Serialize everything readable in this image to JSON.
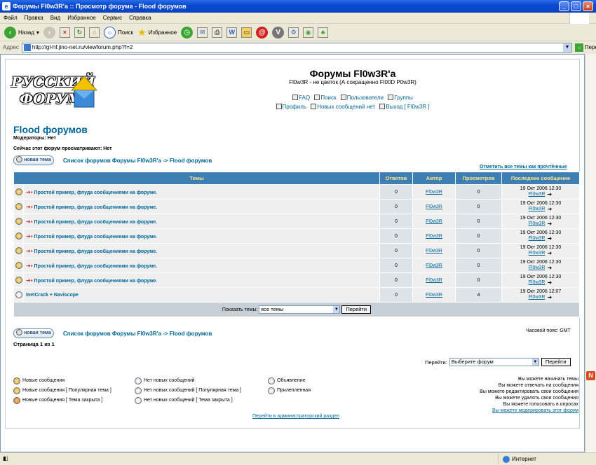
{
  "window": {
    "title": "Форумы Fl0w3R'a :: Просмотр форума - Flood форумов",
    "menu": [
      "Файл",
      "Правка",
      "Вид",
      "Избранное",
      "Сервис",
      "Справка"
    ]
  },
  "toolbar": {
    "back": "Назад",
    "search": "Поиск",
    "favorites": "Избранное"
  },
  "address": {
    "label": "Адрес",
    "url": "http://gl-hf.jino-net.ru/viewforum.php?f=2",
    "go": "Переход"
  },
  "header": {
    "logo_line1": "РУССКИЙ",
    "logo_line2": "ФОРУМ",
    "site_title": "Форумы Fl0w3R'a",
    "site_desc": "Fl0w3R - не цветок (А сокращенно Fl00D P0w3R)",
    "nav1": [
      "FAQ",
      "Поиск",
      "Пользователи",
      "Группы"
    ],
    "nav2": [
      "Профиль",
      "Новых сообщений нет",
      "Выход [ Fl0w3R ]"
    ]
  },
  "forum": {
    "title": "Flood форумов",
    "moderators": "Модераторы: Нет",
    "viewing": "Сейчас этот форум просматривают: Нет",
    "new_topic": "новая тема",
    "breadcrumb": "Список форумов Форумы Fl0w3R'a -> Flood форумов",
    "mark_all": "Отметить все темы как прочтённые"
  },
  "table": {
    "headers": [
      "Темы",
      "Ответов",
      "Автор",
      "Просмотров",
      "Последнее сообщение"
    ],
    "rows": [
      {
        "title": "Простой пример, флуда сообщениями на форуме.",
        "replies": "0",
        "author": "Fl0w3R",
        "views": "0",
        "last_date": "19 Окт 2006 12:30",
        "last_user": "Fl0w3R"
      },
      {
        "title": "Простой пример, флуда сообщениями на форуме.",
        "replies": "0",
        "author": "Fl0w3R",
        "views": "0",
        "last_date": "19 Окт 2006 12:30",
        "last_user": "Fl0w3R"
      },
      {
        "title": "Простой пример, флуда сообщениями на форуме.",
        "replies": "0",
        "author": "Fl0w3R",
        "views": "0",
        "last_date": "19 Окт 2006 12:30",
        "last_user": "Fl0w3R"
      },
      {
        "title": "Простой пример, флуда сообщениями на форуме.",
        "replies": "0",
        "author": "Fl0w3R",
        "views": "0",
        "last_date": "19 Окт 2006 12:30",
        "last_user": "Fl0w3R"
      },
      {
        "title": "Простой пример, флуда сообщениями на форуме.",
        "replies": "0",
        "author": "Fl0w3R",
        "views": "0",
        "last_date": "19 Окт 2006 12:30",
        "last_user": "Fl0w3R"
      },
      {
        "title": "Простой пример, флуда сообщениями на форуме.",
        "replies": "0",
        "author": "Fl0w3R",
        "views": "0",
        "last_date": "19 Окт 2006 12:30",
        "last_user": "Fl0w3R"
      },
      {
        "title": "Простой пример, флуда сообщениями на форуме.",
        "replies": "0",
        "author": "Fl0w3R",
        "views": "0",
        "last_date": "19 Окт 2006 12:30",
        "last_user": "Fl0w3R"
      },
      {
        "title": "InetCrack + Naviscope",
        "replies": "0",
        "author": "Fl0w3R",
        "views": "4",
        "last_date": "19 Окт 2006 12:07",
        "last_user": "Fl0w3R"
      }
    ],
    "footer_label": "Показать темы:",
    "footer_select": "все темы",
    "footer_button": "Перейти"
  },
  "bottom": {
    "timezone": "Часовой пояс: GMT",
    "page_count": "Страница 1 из 1",
    "jump_label": "Перейти:",
    "jump_select": "Выберите форум",
    "jump_button": "Перейти"
  },
  "legend": {
    "col1": [
      "Новые сообщения",
      "Новые сообщения [ Популярная тема ]",
      "Новые сообщения [ Тема закрыта ]"
    ],
    "col2": [
      "Нет новых сообщений",
      "Нет новых сообщений [ Популярная тема ]",
      "Нет новых сообщений [ Тема закрыта ]"
    ],
    "col3": [
      "Объявление",
      "Прилепленная"
    ]
  },
  "permissions": [
    "Вы можете начинать темы",
    "Вы можете отвечать на сообщения",
    "Вы можете редактировать свои сообщения",
    "Вы можете удалять свои сообщения",
    "Вы можете голосовать в опросах",
    "Вы можете модерировать этот форум"
  ],
  "admin_link": "Перейти в администраторский раздел",
  "status": {
    "zone": "Интернет"
  },
  "colors": {
    "header_blue": "#3d7fb5",
    "link_blue": "#006699",
    "header_text": "#ffe68a",
    "row_light": "#efefef",
    "row_dark": "#dee3e7"
  }
}
